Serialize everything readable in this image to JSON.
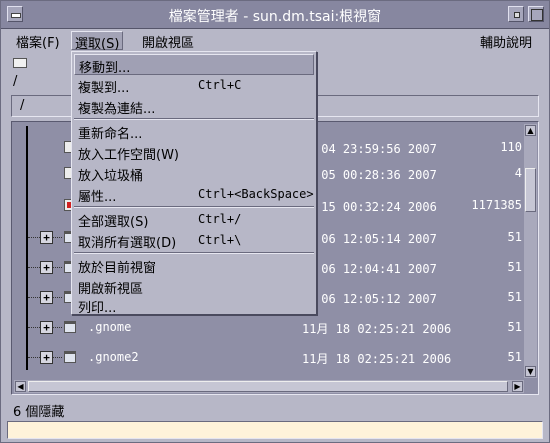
{
  "window": {
    "title": "檔案管理者 - sun.dm.tsai:根視窗"
  },
  "menubar": {
    "file": "檔案(F)",
    "select": "選取(S)",
    "open_view": "開啟視區",
    "help": "輔助說明"
  },
  "toolbar": {
    "path_short": "/",
    "path_box": "/"
  },
  "select_menu": {
    "items": [
      {
        "label": "移動到...",
        "accel": ""
      },
      {
        "label": "複製到...",
        "accel": "Ctrl+C"
      },
      {
        "label": "複製為連結...",
        "accel": ""
      },
      {
        "label": "重新命名...",
        "accel": ""
      },
      {
        "label": "放入工作空間(W)",
        "accel": ""
      },
      {
        "label": "放入垃圾桶",
        "accel": ""
      },
      {
        "label": "屬性...",
        "accel": "Ctrl+<BackSpace>"
      },
      {
        "label": "全部選取(S)",
        "accel": "Ctrl+/"
      },
      {
        "label": "取消所有選取(D)",
        "accel": "Ctrl+\\"
      },
      {
        "label": "放於目前視窗",
        "accel": ""
      },
      {
        "label": "開啟新視區",
        "accel": ""
      },
      {
        "label": "列印...",
        "accel": ""
      }
    ]
  },
  "files": [
    {
      "name": "",
      "date": "月 04 23:59:56 2007",
      "size": "110",
      "icon": "doc-icon"
    },
    {
      "name": "",
      "date": "月 05 00:28:36 2007",
      "size": "4",
      "icon": "doc-icon"
    },
    {
      "name": "",
      "date": "月 15 00:32:24 2006",
      "size": "1171385",
      "icon": "image-file-icon"
    },
    {
      "name": "",
      "date": "月 06 12:05:14 2007",
      "size": "51",
      "icon": "folder-icon"
    },
    {
      "name": "",
      "date": "月 06 12:04:41 2007",
      "size": "51",
      "icon": "folder-icon"
    },
    {
      "name": "",
      "date": "月 06 12:05:12 2007",
      "size": "51",
      "icon": "folder-icon"
    },
    {
      "name": ".gnome",
      "date": "11月 18 02:25:21 2006",
      "size": "51",
      "icon": "folder-icon"
    },
    {
      "name": ".gnome2",
      "date": "11月 18 02:25:21 2006",
      "size": "51",
      "icon": "folder-icon"
    }
  ],
  "status": {
    "hidden_count": "6 個隱藏"
  }
}
